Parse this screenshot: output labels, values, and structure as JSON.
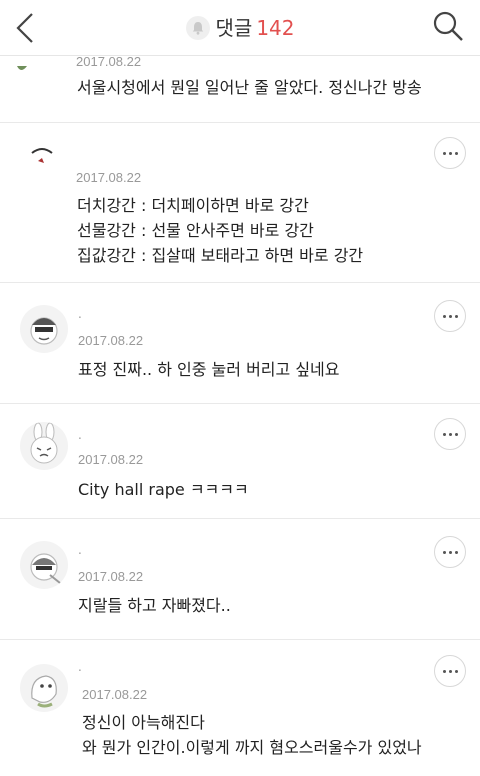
{
  "header": {
    "title": "댓글",
    "count": "142",
    "back_icon": "chevron-left-icon",
    "search_icon": "search-icon",
    "bell_icon": "bell-icon"
  },
  "comments": [
    {
      "date": "2017.08.22",
      "nickname": "",
      "lines": [
        "서울시청에서 뭔일 일어난 줄 알았다. 정신나간 방송"
      ]
    },
    {
      "date": "2017.08.22",
      "nickname": "",
      "lines": [
        "더치강간 : 더치페이하면 바로 강간",
        "선물강간 : 선물 안사주면 바로 강간",
        "집값강간 : 집살때 보태라고 하면 바로 강간"
      ]
    },
    {
      "date": "2017.08.22",
      "nickname": ".",
      "lines": [
        "표정 진짜.. 하 인중 눌러 버리고 싶네요"
      ]
    },
    {
      "date": "2017.08.22",
      "nickname": ".",
      "lines": [
        "City hall rape ㅋㅋㅋㅋ"
      ]
    },
    {
      "date": "2017.08.22",
      "nickname": ".",
      "lines": [
        "지랄들 하고 자빠졌다.."
      ]
    },
    {
      "date": "2017.08.22",
      "nickname": ".",
      "lines": [
        "정신이 아늑해진다",
        "와 뭔가 인간이.이렇게 까지 혐오스러울수가 있었나"
      ]
    }
  ],
  "colors": {
    "accent": "#e2504f",
    "muted": "#999999",
    "divider": "#e9e9e9"
  }
}
